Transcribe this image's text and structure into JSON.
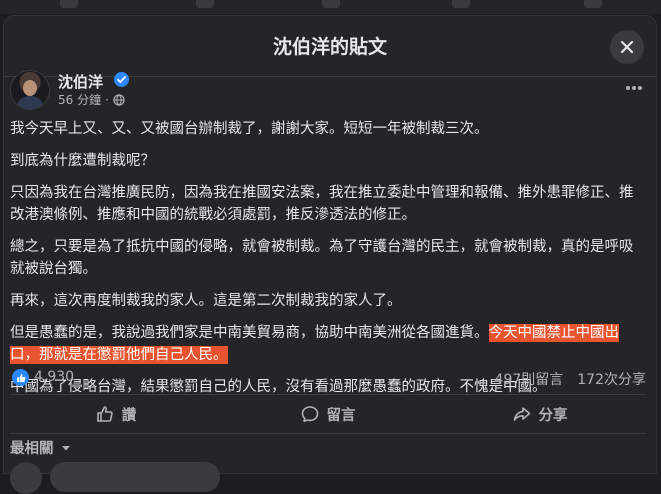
{
  "modal": {
    "title": "沈伯洋的貼文"
  },
  "post": {
    "author": "沈伯洋",
    "time": "56 分鐘",
    "paragraphs": [
      "我今天早上又、又、又被國台辦制裁了，謝謝大家。短短一年被制裁三次。",
      "到底為什麼遭制裁呢？",
      "只因為我在台灣推廣民防，因為我在推國安法案，我在推立委赴中管理和報備、推外患罪修正、推改港澳條例、推應和中國的統戰必須處罰，推反滲透法的修正。",
      "總之，只要是為了抵抗中國的侵略，就會被制裁。為了守護台灣的民主，就會被制裁，真的是呼吸就被說台獨。",
      "再來，這次再度制裁我的家人。這是第二次制裁我的家人了。"
    ],
    "para6_plain": "但是愚蠢的是，我說過我們家是中南美貿易商，協助中南美洲從各國進貨。",
    "para6_highlight": "今天中國禁止中國出口，那就是在懲罰他們自己人民。",
    "para7": "中國為了侵略台灣，結果懲罰自己的人民，沒有看過那麼愚蠢的政府。不愧是中國。"
  },
  "stats": {
    "likes": "4,930",
    "comments": "497則留言",
    "shares": "172次分享"
  },
  "actions": {
    "like": "讚",
    "comment": "留言",
    "share": "分享"
  },
  "sort": {
    "label": "最相關"
  },
  "colors": {
    "highlight": "#e8542f",
    "accent": "#2d88ff"
  }
}
